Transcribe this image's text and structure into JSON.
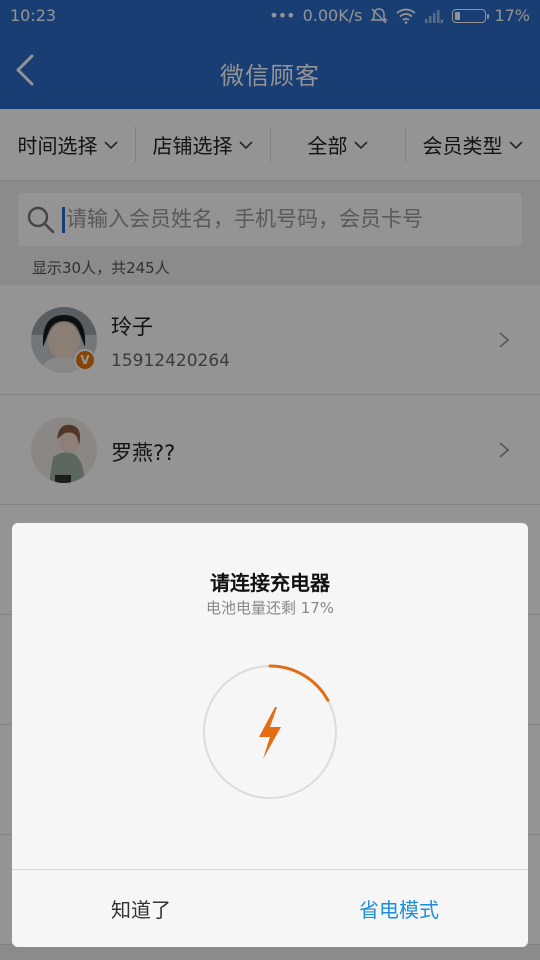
{
  "statusbar": {
    "time": "10:23",
    "network_speed": "0.00K/s",
    "battery_text": "17%",
    "battery_level": 0.17
  },
  "appbar": {
    "title": "微信顾客"
  },
  "filters": [
    {
      "label": "时间选择"
    },
    {
      "label": "店铺选择"
    },
    {
      "label": "全部"
    },
    {
      "label": "会员类型"
    }
  ],
  "search": {
    "placeholder": "请输入会员姓名，手机号码，会员卡号",
    "count_text": "显示30人，共245人"
  },
  "customers": [
    {
      "name": "玲子",
      "phone": "15912420264",
      "badge": "V"
    },
    {
      "name": "罗燕??",
      "phone": ""
    }
  ],
  "dialog": {
    "title": "请连接充电器",
    "subtitle": "电池电量还剩 17%",
    "battery_level": 0.17,
    "accent_color": "#e46c12",
    "dismiss_label": "知道了",
    "power_save_label": "省电模式"
  },
  "colors": {
    "primary": "#2c6cc9",
    "link": "#1f8fd8",
    "badge": "#e6780e"
  }
}
